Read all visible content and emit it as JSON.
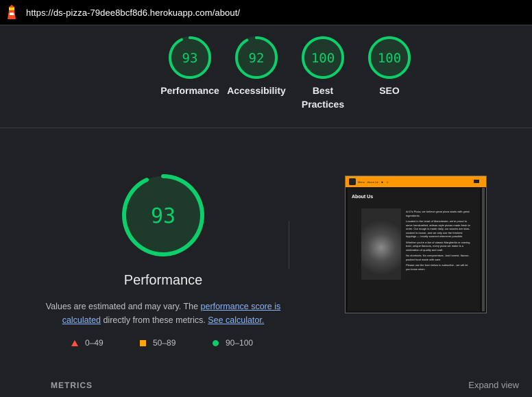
{
  "url": "https://ds-pizza-79dee8bcf8d6.herokuapp.com/about/",
  "colors": {
    "pass": "#0cce6b",
    "average": "#ffa400",
    "fail": "#ff4e42",
    "link": "#8ab4f8"
  },
  "gauges": [
    {
      "score": "93",
      "value": 0.93,
      "label": "Performance"
    },
    {
      "score": "92",
      "value": 0.92,
      "label": "Accessibility"
    },
    {
      "score": "100",
      "value": 1.0,
      "label": "Best Practices"
    },
    {
      "score": "100",
      "value": 1.0,
      "label": "SEO"
    }
  ],
  "main": {
    "score": "93",
    "value": 0.93,
    "title": "Performance",
    "desc_part1": "Values are estimated and may vary. The ",
    "desc_link1": "performance score is calculated",
    "desc_part2": " directly from these metrics. ",
    "desc_link2": "See calculator."
  },
  "legend": [
    {
      "icon": "red-triangle",
      "label": "0–49"
    },
    {
      "icon": "orange-square",
      "label": "50–89"
    },
    {
      "icon": "green-circle",
      "label": "90–100"
    }
  ],
  "thumbnail": {
    "heading": "About Us",
    "nav_text": "Menu · About Us · ☻ · ☺",
    "paragraphs": [
      "At D's Pizza, we believe great pizza starts with great ingredients.",
      "Located in the heart of Manchester, we're proud to serve handcrafted, artisan-style pizzas made fresh to order. Our dough is made daily, our sauces are slow-cooked in-house, and we only use the freshest toppings — locally sourced whenever possible.",
      "Whether you're a fan of classic Margherita or craving bold, unique flavours, every pizza we make is a celebration of quality and craft.",
      "No shortcuts. No compromises. Just honest, flavour-packed food made with care.",
      "Please use the form below to subscribe - we will let you know when"
    ]
  },
  "metrics": {
    "label": "METRICS",
    "expand": "Expand view"
  }
}
